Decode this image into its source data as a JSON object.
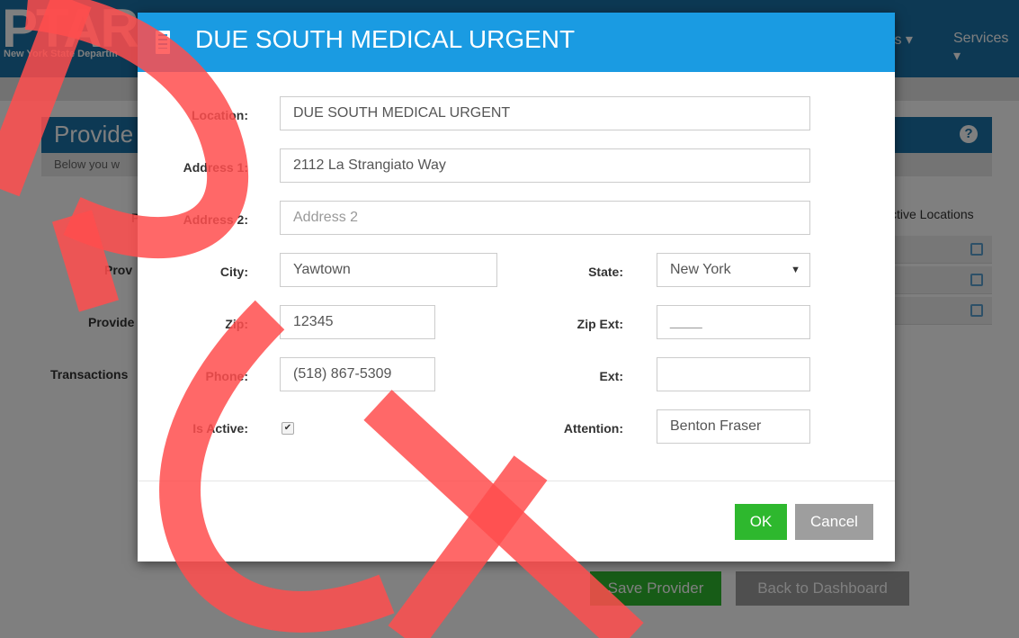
{
  "background": {
    "logo": "PTAR",
    "logo_sub": "New York State Departm",
    "nav": [
      "ts ▾",
      "Services ▾"
    ],
    "panel_title": "Provide",
    "panel_sub": "Below you w",
    "labels": [
      "P",
      "Prov",
      "Provide",
      "Transactions"
    ],
    "active_locations": "ctive Locations",
    "save_label": "Save Provider",
    "back_label": "Back to Dashboard"
  },
  "modal": {
    "title": "DUE SOUTH MEDICAL URGENT",
    "fields": {
      "location": {
        "label": "Location:",
        "value": "DUE SOUTH MEDICAL URGENT"
      },
      "address1": {
        "label": "Address 1:",
        "value": "2112 La Strangiato Way"
      },
      "address2": {
        "label": "Address 2:",
        "value": "",
        "placeholder": "Address 2"
      },
      "city": {
        "label": "City:",
        "value": "Yawtown"
      },
      "state": {
        "label": "State:",
        "value": "New York"
      },
      "zip": {
        "label": "Zip:",
        "value": "12345"
      },
      "zip_ext": {
        "label": "Zip Ext:",
        "value": "____"
      },
      "phone": {
        "label": "Phone:",
        "value": "(518) 867-5309"
      },
      "ext": {
        "label": "Ext:",
        "value": ""
      },
      "is_active": {
        "label": "Is Active:",
        "checked": true
      },
      "attention": {
        "label": "Attention:",
        "value": "Benton Fraser"
      }
    },
    "ok_label": "OK",
    "cancel_label": "Cancel"
  },
  "colors": {
    "header": "#1a9be2",
    "ok": "#2eb82e",
    "cancel": "#9e9e9e",
    "watermark": "#ff4d4d"
  }
}
